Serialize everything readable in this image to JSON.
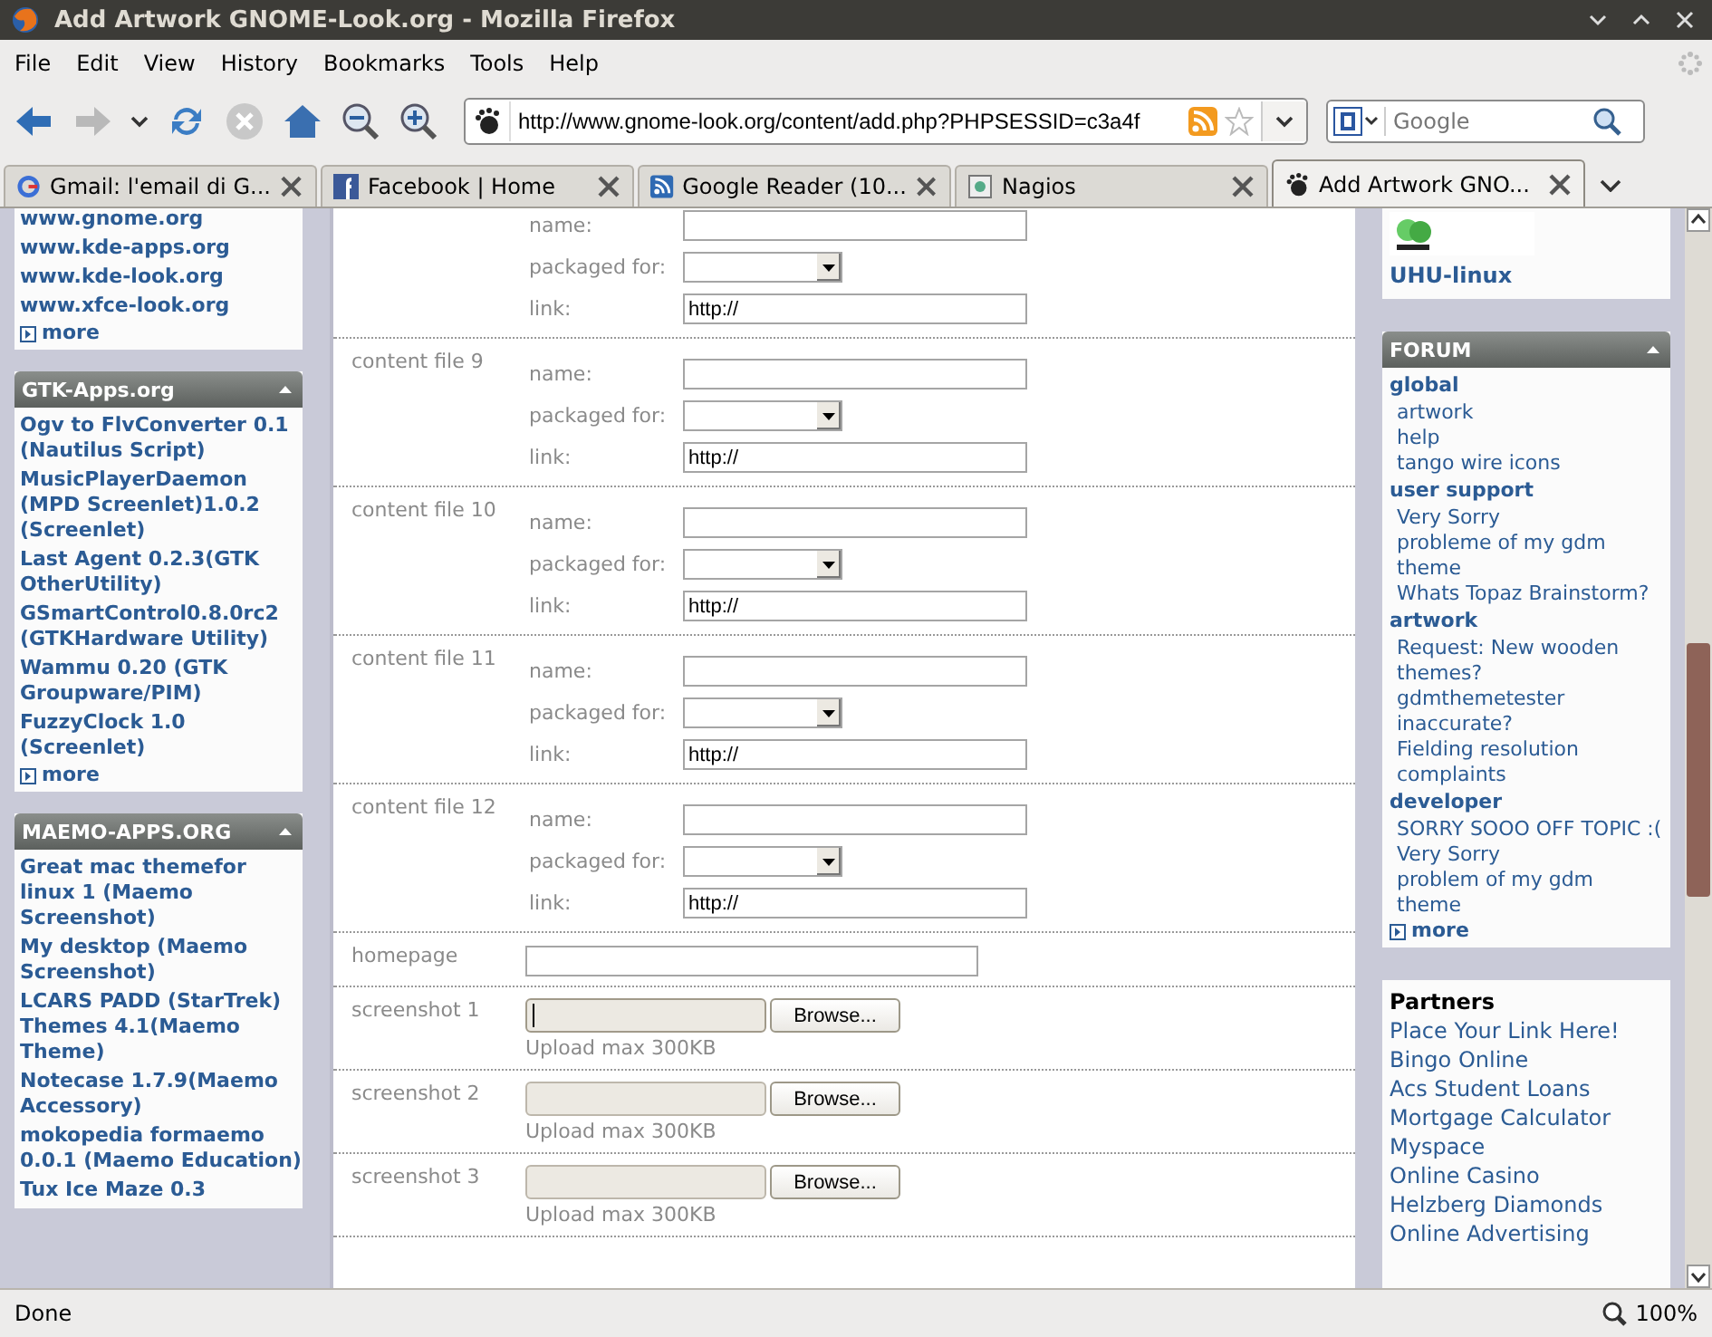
{
  "window": {
    "title": "Add Artwork GNOME-Look.org - Mozilla Firefox"
  },
  "menu": [
    "File",
    "Edit",
    "View",
    "History",
    "Bookmarks",
    "Tools",
    "Help"
  ],
  "address": {
    "value": "http://www.gnome-look.org/content/add.php?PHPSESSID=c3a4f"
  },
  "search": {
    "placeholder": "Google"
  },
  "tabs": [
    {
      "label": "Gmail: l'email di G...",
      "selected": false
    },
    {
      "label": "Facebook | Home",
      "selected": false
    },
    {
      "label": "Google Reader (10...",
      "selected": false
    },
    {
      "label": "Nagios",
      "selected": false
    },
    {
      "label": "Add Artwork GNO...",
      "selected": true
    }
  ],
  "left_panels": [
    {
      "links": [
        "www.gnome.org",
        "www.kde-apps.org",
        "www.kde-look.org",
        "www.xfce-look.org"
      ],
      "more": "more"
    },
    {
      "title": "GTK-Apps.org",
      "links": [
        "Ogv to FlvConverter 0.1 (Nautilus Script)",
        "MusicPlayerDaemon (MPD Screenlet)1.0.2 (Screenlet)",
        "Last Agent 0.2.3(GTK OtherUtility)",
        "GSmartControl0.8.0rc2 (GTKHardware Utility)",
        "Wammu 0.20 (GTK Groupware/PIM)",
        "FuzzyClock 1.0 (Screenlet)"
      ],
      "more": "more"
    },
    {
      "title": "MAEMO-APPS.ORG",
      "links": [
        "Great mac themefor linux 1 (Maemo Screenshot)",
        "My desktop (Maemo Screenshot)",
        "LCARS PADD (StarTrek) Themes 4.1(Maemo Theme)",
        "Notecase 1.7.9(Maemo Accessory)",
        "mokopedia formaemo 0.0.1 (Maemo Education)",
        "Tux Ice Maze 0.3"
      ]
    }
  ],
  "form": {
    "groups": [
      {
        "fields": [
          {
            "kind": "text",
            "label": "name:"
          },
          {
            "kind": "select",
            "label": "packaged for:"
          },
          {
            "kind": "text",
            "label": "link:",
            "value": "http://"
          }
        ]
      },
      {
        "title": "content file 9",
        "fields": [
          {
            "kind": "text",
            "label": "name:"
          },
          {
            "kind": "select",
            "label": "packaged for:"
          },
          {
            "kind": "text",
            "label": "link:",
            "value": "http://"
          }
        ]
      },
      {
        "title": "content file 10",
        "fields": [
          {
            "kind": "text",
            "label": "name:"
          },
          {
            "kind": "select",
            "label": "packaged for:"
          },
          {
            "kind": "text",
            "label": "link:",
            "value": "http://"
          }
        ]
      },
      {
        "title": "content file 11",
        "fields": [
          {
            "kind": "text",
            "label": "name:"
          },
          {
            "kind": "select",
            "label": "packaged for:"
          },
          {
            "kind": "text",
            "label": "link:",
            "value": "http://"
          }
        ]
      },
      {
        "title": "content file 12",
        "fields": [
          {
            "kind": "text",
            "label": "name:"
          },
          {
            "kind": "select",
            "label": "packaged for:"
          },
          {
            "kind": "text",
            "label": "link:",
            "value": "http://"
          }
        ]
      }
    ],
    "homepage": {
      "label": "homepage"
    },
    "screenshots": [
      {
        "label": "screenshot 1",
        "button": "Browse...",
        "note": "Upload max 300KB",
        "focused": true
      },
      {
        "label": "screenshot 2",
        "button": "Browse...",
        "note": "Upload max 300KB",
        "focused": false
      },
      {
        "label": "screenshot 3",
        "button": "Browse...",
        "note": "Upload max 300KB",
        "focused": false
      }
    ]
  },
  "right": {
    "sponsor": "UHU-linux",
    "forum": {
      "title": "FORUM",
      "sections": [
        {
          "title": "global",
          "links": [
            "artwork",
            "help",
            "tango wire icons"
          ]
        },
        {
          "title": "user support",
          "links": [
            "Very Sorry",
            "probleme of my gdm theme",
            "Whats Topaz Brainstorm?"
          ]
        },
        {
          "title": "artwork",
          "links": [
            "Request: New wooden themes?",
            "gdmthemetester inaccurate?",
            "Fielding resolution complaints"
          ]
        },
        {
          "title": "developer",
          "links": [
            "SORRY SOOO OFF TOPIC :(",
            "Very Sorry",
            "problem of my gdm theme"
          ]
        }
      ],
      "more": "more"
    },
    "partners": {
      "title": "Partners",
      "links": [
        "Place Your Link Here!",
        "Bingo Online",
        "Acs Student Loans",
        "Mortgage Calculator",
        "Myspace",
        "Online Casino",
        "Helzberg Diamonds",
        "Online Advertising"
      ]
    }
  },
  "status": {
    "text": "Done",
    "zoom": "100%"
  }
}
